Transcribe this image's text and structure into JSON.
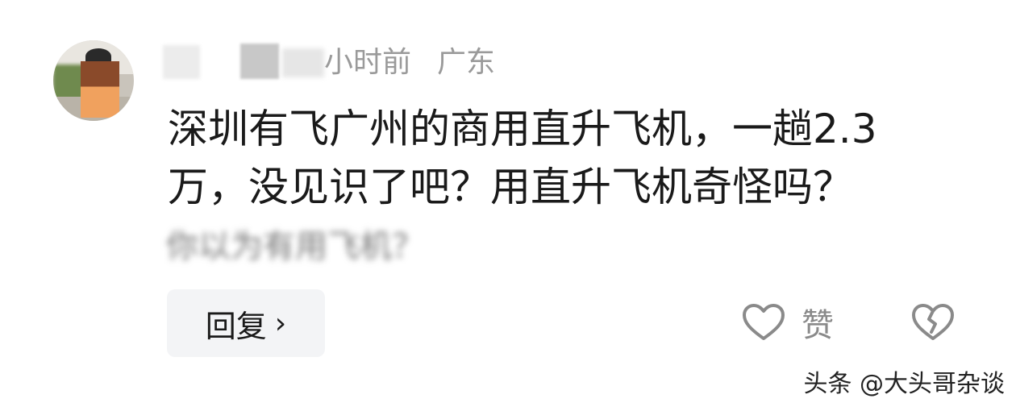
{
  "comment": {
    "time_text": "小时前",
    "location": "广东",
    "lines": [
      "深圳有飞广州的商用直升飞机，一趟2.3",
      "万，没见识了吧？用直升飞机奇怪吗？"
    ],
    "quoted_text": "你以为有用飞机？"
  },
  "actions": {
    "reply_label": "回复",
    "reply_chevron": "›",
    "like_label": "赞",
    "like_icon": "heart-outline-icon",
    "dislike_icon": "broken-heart-icon"
  },
  "watermark": "头条 @大头哥杂谈",
  "colors": {
    "text_primary": "#1a1a1a",
    "text_secondary": "#9a9a9a",
    "reply_bg": "#f3f4f6",
    "icon_gray": "#8a8a8a"
  }
}
